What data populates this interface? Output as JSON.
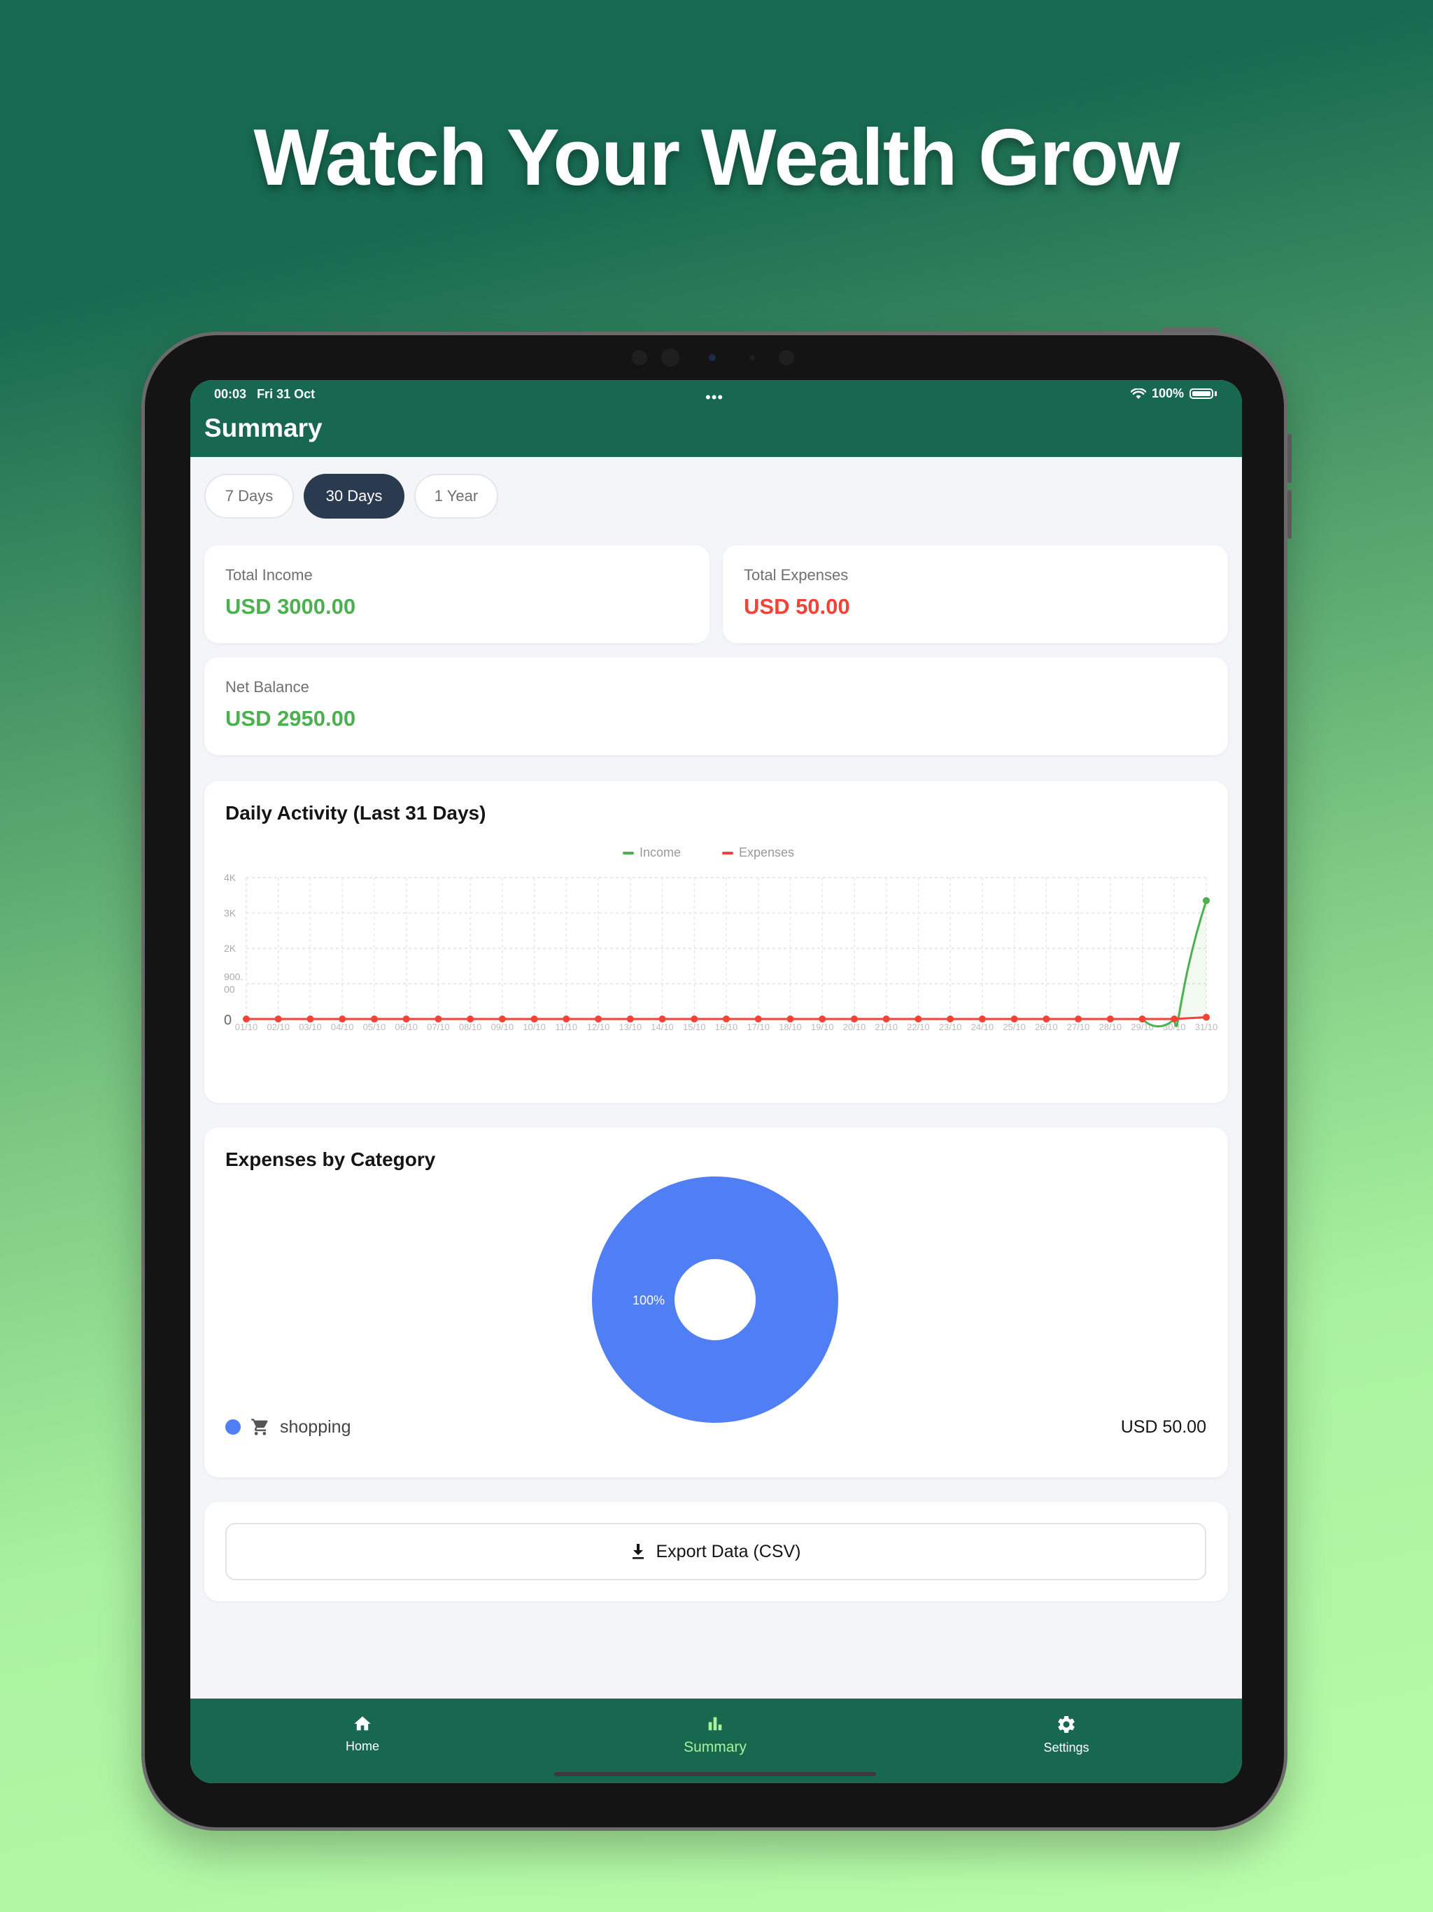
{
  "headline": "Watch Your Wealth Grow",
  "status_bar": {
    "time": "00:03",
    "date": "Fri 31 Oct",
    "battery": "100%"
  },
  "header": {
    "title": "Summary"
  },
  "period_tabs": [
    {
      "label": "7 Days",
      "selected": false
    },
    {
      "label": "30 Days",
      "selected": true
    },
    {
      "label": "1 Year",
      "selected": false
    }
  ],
  "stats": {
    "total_income": {
      "label": "Total Income",
      "value": "USD 3000.00"
    },
    "total_expenses": {
      "label": "Total Expenses",
      "value": "USD 50.00"
    },
    "net_balance": {
      "label": "Net Balance",
      "value": "USD 2950.00"
    }
  },
  "daily_chart": {
    "title": "Daily Activity (Last 31 Days)",
    "legend": [
      "Income",
      "Expenses"
    ]
  },
  "chart_data": {
    "type": "line",
    "title": "Daily Activity (Last 31 Days)",
    "x": [
      "01/10",
      "02/10",
      "03/10",
      "04/10",
      "05/10",
      "06/10",
      "07/10",
      "08/10",
      "09/10",
      "10/10",
      "11/10",
      "12/10",
      "13/10",
      "14/10",
      "15/10",
      "16/10",
      "17/10",
      "18/10",
      "19/10",
      "20/10",
      "21/10",
      "22/10",
      "23/10",
      "24/10",
      "25/10",
      "26/10",
      "27/10",
      "28/10",
      "29/10",
      "30/10",
      "31/10"
    ],
    "y_ticks": [
      "0",
      "900.\n00",
      "2K",
      "3K",
      "4K"
    ],
    "ylim": [
      0,
      4000
    ],
    "series": [
      {
        "name": "Income",
        "color": "#4caf50",
        "values": [
          0,
          0,
          0,
          0,
          0,
          0,
          0,
          0,
          0,
          0,
          0,
          0,
          0,
          0,
          0,
          0,
          0,
          0,
          0,
          0,
          0,
          0,
          0,
          0,
          0,
          0,
          0,
          0,
          0,
          0,
          3350
        ]
      },
      {
        "name": "Expenses",
        "color": "#f44336",
        "values": [
          0,
          0,
          0,
          0,
          0,
          0,
          0,
          0,
          0,
          0,
          0,
          0,
          0,
          0,
          0,
          0,
          0,
          0,
          0,
          0,
          0,
          0,
          0,
          0,
          0,
          0,
          0,
          0,
          0,
          0,
          50
        ]
      }
    ],
    "grid": true,
    "legend_position": "top-center"
  },
  "category_chart": {
    "title": "Expenses by Category",
    "slice_label": "100%",
    "slice_color": "#507ff5",
    "items": [
      {
        "name": "shopping",
        "amount": "USD 50.00",
        "share": 1.0,
        "icon": "cart-icon"
      }
    ]
  },
  "export": {
    "label": "Export Data (CSV)",
    "icon": "download-icon"
  },
  "bottom_nav": [
    {
      "label": "Home",
      "icon": "home-icon",
      "active": false
    },
    {
      "label": "Summary",
      "icon": "bar-chart-icon",
      "active": true
    },
    {
      "label": "Settings",
      "icon": "gear-icon",
      "active": false
    }
  ]
}
